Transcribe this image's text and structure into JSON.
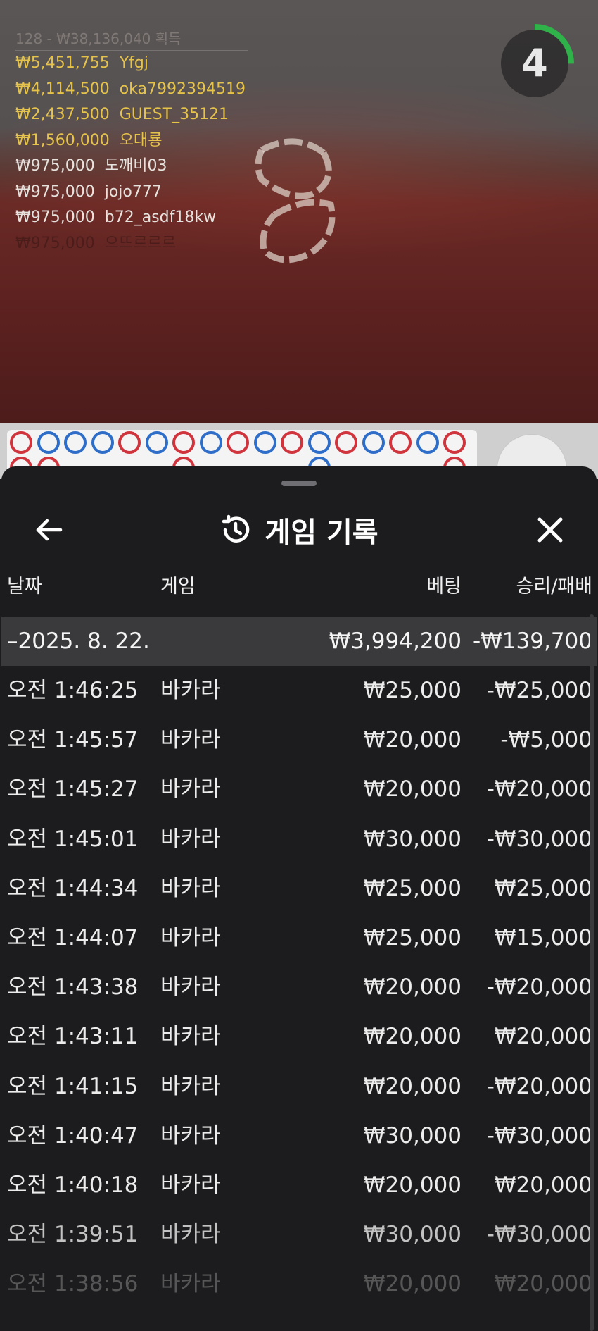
{
  "game": {
    "winners_total": "128 - ₩38,136,040 획득",
    "winners": [
      {
        "amount": "₩5,451,755",
        "name": "Yfgj",
        "style": "gold"
      },
      {
        "amount": "₩4,114,500",
        "name": "oka7992394519",
        "style": "gold"
      },
      {
        "amount": "₩2,437,500",
        "name": "GUEST_35121",
        "style": "gold"
      },
      {
        "amount": "₩1,560,000",
        "name": "오대룡",
        "style": "gold"
      },
      {
        "amount": "₩975,000",
        "name": "도깨비03",
        "style": "plain"
      },
      {
        "amount": "₩975,000",
        "name": "jojo777",
        "style": "plain"
      },
      {
        "amount": "₩975,000",
        "name": "b72_asdf18kw",
        "style": "plain"
      },
      {
        "amount": "₩975,000",
        "name": "으뜨르르르",
        "style": "fade"
      }
    ],
    "timer": "4",
    "timer_color": "#2fb24a",
    "roadmap_row1": [
      "red",
      "blue",
      "blue",
      "blue",
      "red",
      "blue",
      "red",
      "blue",
      "red",
      "blue",
      "red",
      "blue",
      "red",
      "blue",
      "red",
      "blue",
      "red"
    ],
    "roadmap_row2": [
      "red",
      "red",
      "",
      "",
      "",
      "",
      "red",
      "",
      "",
      "",
      "",
      "blue",
      "",
      "",
      "",
      "",
      "red"
    ],
    "colors": {
      "banker": "#d0343c",
      "player": "#2f6ec8"
    }
  },
  "sheet": {
    "title": "게임 기록",
    "back_icon": "arrow-left-icon",
    "title_icon": "history-icon",
    "close_icon": "close-icon",
    "columns": {
      "date": "날짜",
      "game": "게임",
      "bet": "베팅",
      "winloss": "승리/패배"
    },
    "date_group": {
      "date": "–2025. 8. 22.",
      "bet": "₩3,994,200",
      "winloss": "-₩139,700"
    },
    "rows": [
      {
        "time": "오전 1:46:25",
        "game": "바카라",
        "bet": "₩25,000",
        "winloss": "-₩25,000"
      },
      {
        "time": "오전 1:45:57",
        "game": "바카라",
        "bet": "₩20,000",
        "winloss": "-₩5,000"
      },
      {
        "time": "오전 1:45:27",
        "game": "바카라",
        "bet": "₩20,000",
        "winloss": "-₩20,000"
      },
      {
        "time": "오전 1:45:01",
        "game": "바카라",
        "bet": "₩30,000",
        "winloss": "-₩30,000"
      },
      {
        "time": "오전 1:44:34",
        "game": "바카라",
        "bet": "₩25,000",
        "winloss": "₩25,000"
      },
      {
        "time": "오전 1:44:07",
        "game": "바카라",
        "bet": "₩25,000",
        "winloss": "₩15,000"
      },
      {
        "time": "오전 1:43:38",
        "game": "바카라",
        "bet": "₩20,000",
        "winloss": "-₩20,000"
      },
      {
        "time": "오전 1:43:11",
        "game": "바카라",
        "bet": "₩20,000",
        "winloss": "₩20,000"
      },
      {
        "time": "오전 1:41:15",
        "game": "바카라",
        "bet": "₩20,000",
        "winloss": "-₩20,000"
      },
      {
        "time": "오전 1:40:47",
        "game": "바카라",
        "bet": "₩30,000",
        "winloss": "-₩30,000"
      },
      {
        "time": "오전 1:40:18",
        "game": "바카라",
        "bet": "₩20,000",
        "winloss": "₩20,000"
      },
      {
        "time": "오전 1:39:51",
        "game": "바카라",
        "bet": "₩30,000",
        "winloss": "-₩30,000"
      },
      {
        "time": "오전 1:38:56",
        "game": "바카라",
        "bet": "₩20,000",
        "winloss": "₩20,000"
      }
    ]
  }
}
